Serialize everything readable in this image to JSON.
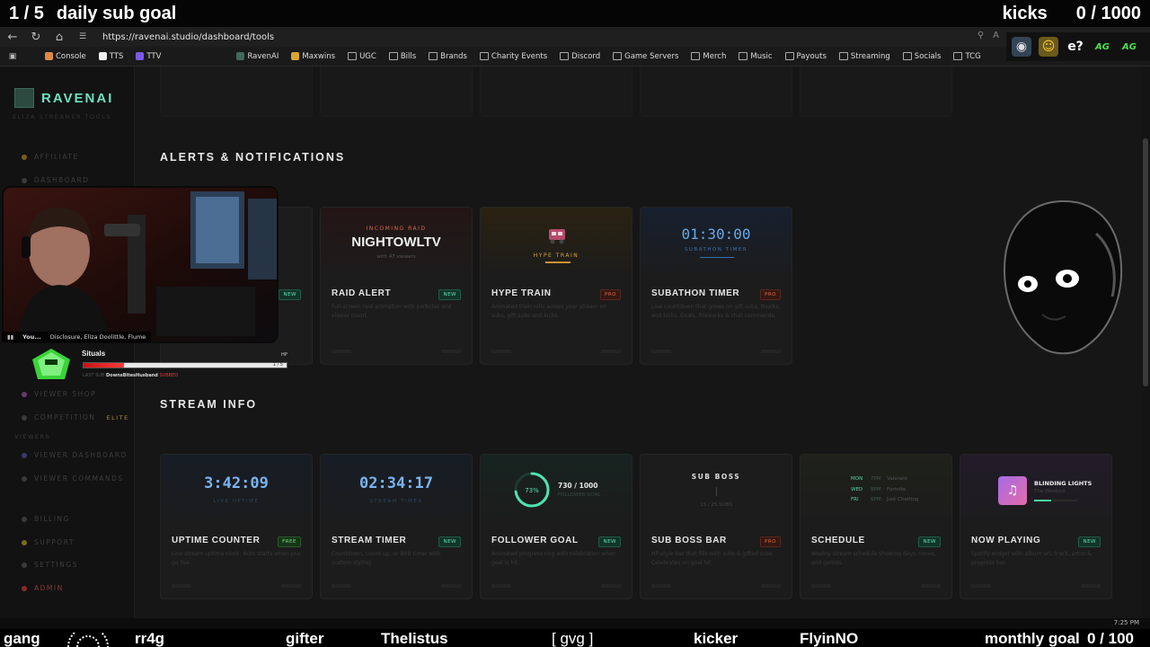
{
  "overlay_top": {
    "sub_counter": "1 / 5",
    "sub_goal_label": "daily sub goal",
    "kicks_label": "kicks",
    "kicks_counter": "0 / 1000"
  },
  "browser": {
    "url": "https://ravenai.studio/dashboard/tools",
    "bookmarks": [
      "Console",
      "TTS",
      "TTV",
      "RavenAI",
      "Maxwins",
      "UGC",
      "Bills",
      "Brands",
      "Charity Events",
      "Discord",
      "Game Servers",
      "Merch",
      "Music",
      "Payouts",
      "Streaming",
      "Socials",
      "TCG"
    ],
    "emotes": [
      "e?",
      "AG",
      "AG"
    ]
  },
  "sidebar": {
    "brand": "RAVENAI",
    "brand_sub": "ELIZA STREAMER TOOLS",
    "items_top": [
      "AFFILIATE",
      "DASHBOARD"
    ],
    "items_mid": [
      "VIEWER SHOP",
      "COMPETITION"
    ],
    "elite_tag": "ELITE",
    "viewers_section": "VIEWERS",
    "viewer_items": [
      "VIEWER DASHBOARD",
      "VIEWER COMMANDS"
    ],
    "items_bottom": [
      "BILLING",
      "SUPPORT",
      "SETTINGS"
    ],
    "admin": "ADMIN"
  },
  "alerts": {
    "section_title": "ALERTS & NOTIFICATIONS",
    "cards": [
      {
        "title": "RAID ALERT",
        "badge": "NEW",
        "desc": "Full-screen raid animation with particles and viewer count.",
        "preview": {
          "kicker": "INCOMING RAID",
          "name": "NIGHTOWLTV",
          "sub": "with 47 viewers"
        }
      },
      {
        "title": "HYPE TRAIN",
        "badge": "PRO",
        "desc": "Animated train rolls across your stream on subs, gift subs and kicks.",
        "preview": {
          "label": "HYPE TRAIN"
        }
      },
      {
        "title": "SUBATHON TIMER",
        "badge": "PRO",
        "desc": "Live countdown that grows on gift subs, tbucks, and kicks. Goals, fireworks & chat commands.",
        "preview": {
          "time": "01:30:00",
          "label": "SUBATHON TIMER"
        }
      }
    ],
    "partial_badge": "NEW"
  },
  "stream_info": {
    "section_title": "STREAM INFO",
    "cards": [
      {
        "title": "UPTIME COUNTER",
        "badge": "FREE",
        "desc": "Live stream uptime clock. Auto starts when you go live.",
        "preview": {
          "time": "3:42:09",
          "label": "LIVE UPTIME"
        }
      },
      {
        "title": "STREAM TIMER",
        "badge": "NEW",
        "desc": "Countdown, count-up, or BRB timer with custom styling.",
        "preview": {
          "time": "02:34:17",
          "label": "STREAM TIMER"
        }
      },
      {
        "title": "FOLLOWER GOAL",
        "badge": "NEW",
        "desc": "Animated progress ring with celebration when goal is hit.",
        "preview": {
          "percent": "73%",
          "percent_value": 0.73,
          "count": "730 / 1000",
          "label": "FOLLOWER GOAL"
        }
      },
      {
        "title": "SUB BOSS BAR",
        "badge": "PRO",
        "desc": "HP-style bar that fills with subs & gifted subs. Celebrates on goal hit.",
        "preview": {
          "title": "SUB BOSS",
          "count": "15 / 25 SUBS"
        }
      },
      {
        "title": "SCHEDULE",
        "badge": "NEW",
        "desc": "Weekly stream schedule showing days, times, and games.",
        "preview": {
          "rows": [
            {
              "day": "MON",
              "time": "7PM",
              "game": "Valorant"
            },
            {
              "day": "WED",
              "time": "8PM",
              "game": "Fortnite"
            },
            {
              "day": "FRI",
              "time": "6PM",
              "game": "Just Chatting"
            }
          ]
        }
      },
      {
        "title": "NOW PLAYING",
        "badge": "NEW",
        "desc": "Spotify widget with album art, track, artist & progress bar.",
        "preview": {
          "track": "BLINDING LIGHTS",
          "artist": "The Weeknd",
          "progress": 0.4
        }
      }
    ]
  },
  "camera": {
    "caption_name": "You...",
    "caption_text": "Disclosure, Eliza Doolittle, Flume"
  },
  "boss_widget": {
    "name": "Situals",
    "hp_label": "HP",
    "count": "1 / 5",
    "progress": 0.2,
    "last_label": "LAST SUB",
    "last_name": "DownsBitesHusband",
    "last_tag": "SUBBED"
  },
  "taskbar": {
    "time": "7:25 PM"
  },
  "ticker": {
    "items": [
      "gang",
      "rr4g",
      "gifter",
      "Thelistus",
      "[ gvg ]",
      "kicker",
      "FlyinNO"
    ],
    "monthly_label": "monthly goal",
    "monthly_counter": "0 / 100"
  }
}
